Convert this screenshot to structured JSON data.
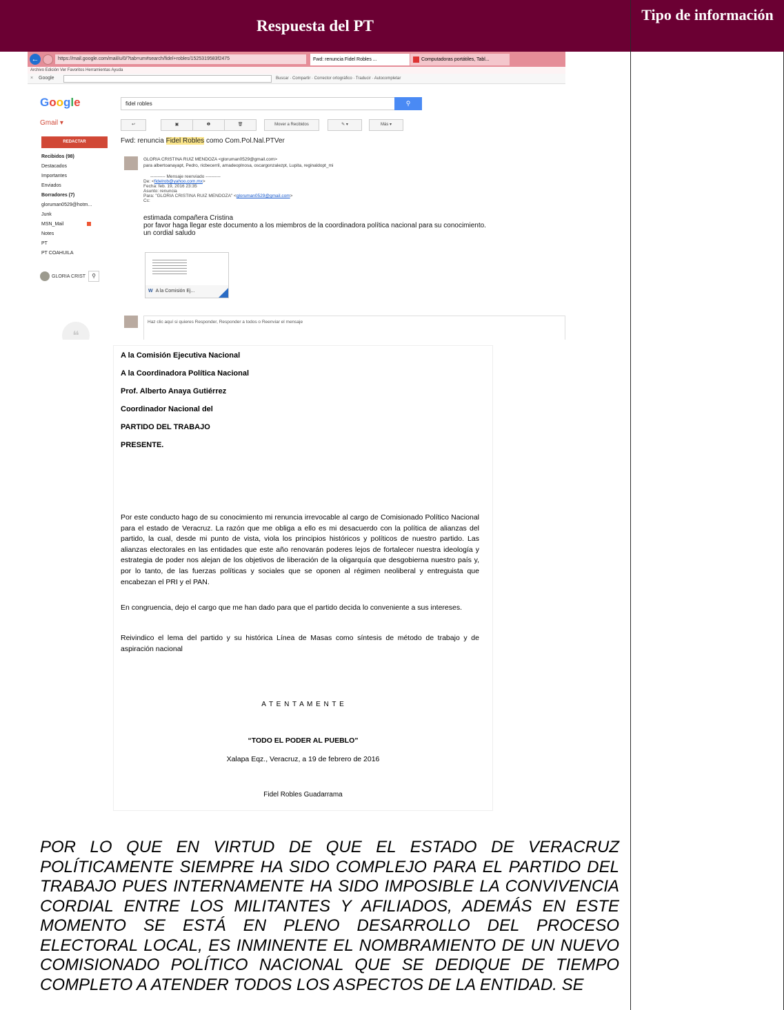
{
  "table": {
    "header_main": "Respuesta del PT",
    "header_side": "Tipo de información"
  },
  "browser": {
    "url": "https://mail.google.com/mail/u/0/?tab=um#search/fidel+robles/1525319583f2475",
    "tab_active": "Fwd: renuncia Fidel Robles ...",
    "tab_other": "Computadoras portátiles, Tabl...",
    "menu": "Archivo   Edición   Ver   Favoritos   Herramientas   Ayuda",
    "toolbar_g": "Google",
    "toolbar_tools": "Buscar · Compartir · Corrector ortográfico · Traducir · Autocompletar"
  },
  "gmail": {
    "logo": "Google",
    "search_value": "fidel robles",
    "label": "Gmail ▾",
    "compose": "REDACTAR",
    "folders": [
      "Recibidos (98)",
      "Destacados",
      "Importantes",
      "Enviados",
      "Borradores (7)",
      "gloruman0529@hotm...",
      "Junk",
      "MSN_Mail",
      "Notes",
      "PT",
      "PT COAHUILA"
    ],
    "user": "GLORIA CRIST",
    "actions": [
      "↩",
      "▣",
      "❶",
      "🗑",
      "Mover a Recibidos",
      "✎ ▾",
      "Más ▾"
    ],
    "subject_pre": "Fwd: renuncia ",
    "subject_hl": "Fidel Robles",
    "subject_post": " como Com.Pol.Nal.PTVer",
    "sender": "GLORIA CRISTINA RUIZ MENDOZA <gloruman0529@gmail.com>",
    "recipients": "para albertoanayapt, Pedro, ricbecerril, amadeoplnosa, oscargonzalezpt, Lupita, reginaldopt_mi",
    "fwd_line1": "---------- Mensaje reenviado ----------",
    "fwd_line2_a": "De: <",
    "fwd_line2_link": "fidelrob@yahoo.com.mx",
    "fwd_line2_b": ">",
    "fwd_line3": "Fecha: feb. 19, 2016 23:35",
    "fwd_line4": "Asunto: renuncia",
    "fwd_line5_a": "Para: \"GLORIA CRISTINA RUIZ MENDOZA\" <",
    "fwd_line5_link": "gloruman0529@gmail.com",
    "fwd_line5_b": ">",
    "fwd_line6": "Cc:",
    "body_1": "estimada compañera Cristina",
    "body_2": "por favor haga llegar este documento a los miembros de la coordinadora política nacional para su conocimiento.",
    "body_3": "un cordial saludo",
    "attachment": "A la Comisión Ej...",
    "attachment_icon": "W",
    "reply_text": "Haz clic aquí si quieres Responder, Responder a todos o Reenviar el mensaje"
  },
  "letter": {
    "addr1": "A la Comisión Ejecutiva Nacional",
    "addr2": "A la Coordinadora Política Nacional",
    "addr3": "Prof. Alberto Anaya Gutiérrez",
    "addr4": "Coordinador Nacional del",
    "addr5": "PARTIDO DEL TRABAJO",
    "addr6": "PRESENTE.",
    "para1": "Por este conducto hago de su conocimiento mi renuncia irrevocable al cargo de Comisionado Político Nacional para el estado de Veracruz. La razón que me obliga a ello es mi desacuerdo con la política de alianzas del partido, la cual, desde mi punto de vista, viola los principios históricos y políticos de nuestro partido. Las alianzas electorales en las entidades que este año renovarán poderes lejos de fortalecer nuestra ideología y estrategia de poder nos alejan de los objetivos de liberación de la oligarquía que desgobierna nuestro país y, por lo tanto, de las fuerzas políticas y sociales que se oponen al régimen neoliberal y entreguista que encabezan el PRI y el PAN.",
    "para2": "En congruencia, dejo el cargo que me han dado para que el partido decida lo conveniente a sus intereses.",
    "para3": "Reivindico el lema del partido y su histórica Línea de Masas como síntesis de método de trabajo y de aspiración nacional",
    "closing": "A T E N T A M E N T E",
    "motto": "“TODO EL PODER AL PUEBLO”",
    "place_date": "Xalapa Eqz., Veracruz, a 19 de febrero de 2016",
    "signature": "Fidel Robles Guadarrama"
  },
  "italic_paragraph": "POR LO QUE EN VIRTUD DE QUE EL ESTADO DE VERACRUZ POLÍTICAMENTE SIEMPRE HA SIDO COMPLEJO PARA EL PARTIDO DEL TRABAJO PUES INTERNAMENTE HA SIDO IMPOSIBLE LA CONVIVENCIA CORDIAL ENTRE LOS MILITANTES Y AFILIADOS, ADEMÁS EN ESTE MOMENTO SE ESTÁ EN PLENO DESARROLLO DEL PROCESO ELECTORAL LOCAL, ES INMINENTE EL NOMBRAMIENTO DE UN NUEVO COMISIONADO POLÍTICO NACIONAL QUE SE DEDIQUE DE TIEMPO COMPLETO A ATENDER TODOS LOS ASPECTOS DE LA ENTIDAD. SE"
}
